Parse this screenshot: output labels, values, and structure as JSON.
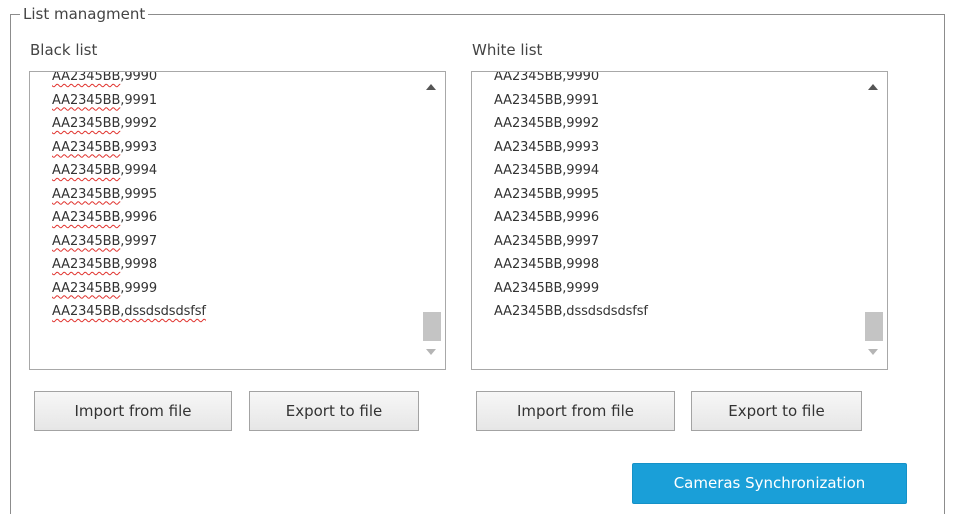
{
  "group": {
    "title": "List managment"
  },
  "black_list": {
    "label": "Black list",
    "items": [
      {
        "plate": "AA2345BB",
        "rest": ",9990"
      },
      {
        "plate": "AA2345BB",
        "rest": ",9991"
      },
      {
        "plate": "AA2345BB",
        "rest": ",9992"
      },
      {
        "plate": "AA2345BB",
        "rest": ",9993"
      },
      {
        "plate": "AA2345BB",
        "rest": ",9994"
      },
      {
        "plate": "AA2345BB",
        "rest": ",9995"
      },
      {
        "plate": "AA2345BB",
        "rest": ",9996"
      },
      {
        "plate": "AA2345BB",
        "rest": ",9997"
      },
      {
        "plate": "AA2345BB",
        "rest": ",9998"
      },
      {
        "plate": "AA2345BB",
        "rest": ",9999"
      },
      {
        "plate": "AA2345BB,dssdsdsdsfsf",
        "rest": ""
      }
    ],
    "import_label": "Import from file",
    "export_label": "Export to file"
  },
  "white_list": {
    "label": "White list",
    "items": [
      "AA2345BB,9990",
      "AA2345BB,9991",
      "AA2345BB,9992",
      "AA2345BB,9993",
      "AA2345BB,9994",
      "AA2345BB,9995",
      "AA2345BB,9996",
      "AA2345BB,9997",
      "AA2345BB,9998",
      "AA2345BB,9999",
      "AA2345BB,dssdsdsdsfsf"
    ],
    "import_label": "Import from file",
    "export_label": "Export to file"
  },
  "sync_button_label": "Cameras Synchronization",
  "colors": {
    "accent": "#1a9fd8",
    "spellcheck": "#e0302b",
    "border": "#a8a8a8"
  }
}
